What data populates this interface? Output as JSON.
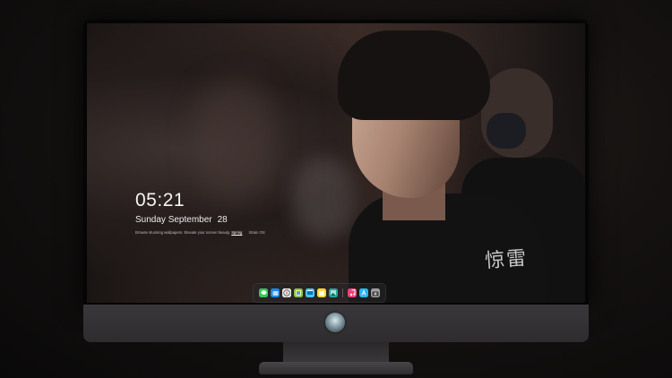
{
  "lock_screen": {
    "time": "05:21",
    "date_day": "Sunday September",
    "date_num": "28",
    "hint_part1": "Browse stunning wallpapers. Elevate your screen beauty.",
    "hint_link": "Spring",
    "hint_part2": "Xtrain OS"
  },
  "wallpaper": {
    "jacket_text": "惊雷"
  },
  "dock": {
    "apps": [
      {
        "icon": "messages-icon",
        "color": "#34c759"
      },
      {
        "icon": "finder-icon",
        "color": "#1e88e5"
      },
      {
        "icon": "safari-icon",
        "color": "#e8e8e8"
      },
      {
        "icon": "photos-icon",
        "color": "#8bc34a"
      },
      {
        "icon": "video-icon",
        "color": "#4fc3f7"
      },
      {
        "icon": "notes-icon",
        "color": "#fdd835"
      },
      {
        "icon": "gallery-icon",
        "color": "#26a69a"
      },
      {
        "icon": "music-icon",
        "color": "#ec407a"
      },
      {
        "icon": "appstore-icon",
        "color": "#29b6f6"
      },
      {
        "icon": "camera-icon",
        "color": "#9e9e9e"
      }
    ]
  }
}
